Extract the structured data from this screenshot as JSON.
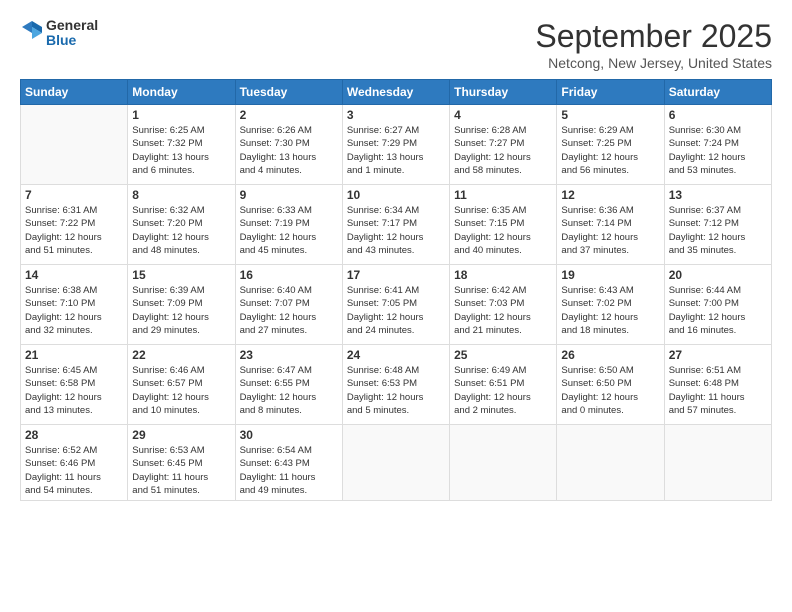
{
  "header": {
    "logo": {
      "general": "General",
      "blue": "Blue"
    },
    "title": "September 2025",
    "location": "Netcong, New Jersey, United States"
  },
  "weekdays": [
    "Sunday",
    "Monday",
    "Tuesday",
    "Wednesday",
    "Thursday",
    "Friday",
    "Saturday"
  ],
  "weeks": [
    [
      {
        "day": "",
        "info": ""
      },
      {
        "day": "1",
        "info": "Sunrise: 6:25 AM\nSunset: 7:32 PM\nDaylight: 13 hours\nand 6 minutes."
      },
      {
        "day": "2",
        "info": "Sunrise: 6:26 AM\nSunset: 7:30 PM\nDaylight: 13 hours\nand 4 minutes."
      },
      {
        "day": "3",
        "info": "Sunrise: 6:27 AM\nSunset: 7:29 PM\nDaylight: 13 hours\nand 1 minute."
      },
      {
        "day": "4",
        "info": "Sunrise: 6:28 AM\nSunset: 7:27 PM\nDaylight: 12 hours\nand 58 minutes."
      },
      {
        "day": "5",
        "info": "Sunrise: 6:29 AM\nSunset: 7:25 PM\nDaylight: 12 hours\nand 56 minutes."
      },
      {
        "day": "6",
        "info": "Sunrise: 6:30 AM\nSunset: 7:24 PM\nDaylight: 12 hours\nand 53 minutes."
      }
    ],
    [
      {
        "day": "7",
        "info": "Sunrise: 6:31 AM\nSunset: 7:22 PM\nDaylight: 12 hours\nand 51 minutes."
      },
      {
        "day": "8",
        "info": "Sunrise: 6:32 AM\nSunset: 7:20 PM\nDaylight: 12 hours\nand 48 minutes."
      },
      {
        "day": "9",
        "info": "Sunrise: 6:33 AM\nSunset: 7:19 PM\nDaylight: 12 hours\nand 45 minutes."
      },
      {
        "day": "10",
        "info": "Sunrise: 6:34 AM\nSunset: 7:17 PM\nDaylight: 12 hours\nand 43 minutes."
      },
      {
        "day": "11",
        "info": "Sunrise: 6:35 AM\nSunset: 7:15 PM\nDaylight: 12 hours\nand 40 minutes."
      },
      {
        "day": "12",
        "info": "Sunrise: 6:36 AM\nSunset: 7:14 PM\nDaylight: 12 hours\nand 37 minutes."
      },
      {
        "day": "13",
        "info": "Sunrise: 6:37 AM\nSunset: 7:12 PM\nDaylight: 12 hours\nand 35 minutes."
      }
    ],
    [
      {
        "day": "14",
        "info": "Sunrise: 6:38 AM\nSunset: 7:10 PM\nDaylight: 12 hours\nand 32 minutes."
      },
      {
        "day": "15",
        "info": "Sunrise: 6:39 AM\nSunset: 7:09 PM\nDaylight: 12 hours\nand 29 minutes."
      },
      {
        "day": "16",
        "info": "Sunrise: 6:40 AM\nSunset: 7:07 PM\nDaylight: 12 hours\nand 27 minutes."
      },
      {
        "day": "17",
        "info": "Sunrise: 6:41 AM\nSunset: 7:05 PM\nDaylight: 12 hours\nand 24 minutes."
      },
      {
        "day": "18",
        "info": "Sunrise: 6:42 AM\nSunset: 7:03 PM\nDaylight: 12 hours\nand 21 minutes."
      },
      {
        "day": "19",
        "info": "Sunrise: 6:43 AM\nSunset: 7:02 PM\nDaylight: 12 hours\nand 18 minutes."
      },
      {
        "day": "20",
        "info": "Sunrise: 6:44 AM\nSunset: 7:00 PM\nDaylight: 12 hours\nand 16 minutes."
      }
    ],
    [
      {
        "day": "21",
        "info": "Sunrise: 6:45 AM\nSunset: 6:58 PM\nDaylight: 12 hours\nand 13 minutes."
      },
      {
        "day": "22",
        "info": "Sunrise: 6:46 AM\nSunset: 6:57 PM\nDaylight: 12 hours\nand 10 minutes."
      },
      {
        "day": "23",
        "info": "Sunrise: 6:47 AM\nSunset: 6:55 PM\nDaylight: 12 hours\nand 8 minutes."
      },
      {
        "day": "24",
        "info": "Sunrise: 6:48 AM\nSunset: 6:53 PM\nDaylight: 12 hours\nand 5 minutes."
      },
      {
        "day": "25",
        "info": "Sunrise: 6:49 AM\nSunset: 6:51 PM\nDaylight: 12 hours\nand 2 minutes."
      },
      {
        "day": "26",
        "info": "Sunrise: 6:50 AM\nSunset: 6:50 PM\nDaylight: 12 hours\nand 0 minutes."
      },
      {
        "day": "27",
        "info": "Sunrise: 6:51 AM\nSunset: 6:48 PM\nDaylight: 11 hours\nand 57 minutes."
      }
    ],
    [
      {
        "day": "28",
        "info": "Sunrise: 6:52 AM\nSunset: 6:46 PM\nDaylight: 11 hours\nand 54 minutes."
      },
      {
        "day": "29",
        "info": "Sunrise: 6:53 AM\nSunset: 6:45 PM\nDaylight: 11 hours\nand 51 minutes."
      },
      {
        "day": "30",
        "info": "Sunrise: 6:54 AM\nSunset: 6:43 PM\nDaylight: 11 hours\nand 49 minutes."
      },
      {
        "day": "",
        "info": ""
      },
      {
        "day": "",
        "info": ""
      },
      {
        "day": "",
        "info": ""
      },
      {
        "day": "",
        "info": ""
      }
    ]
  ]
}
